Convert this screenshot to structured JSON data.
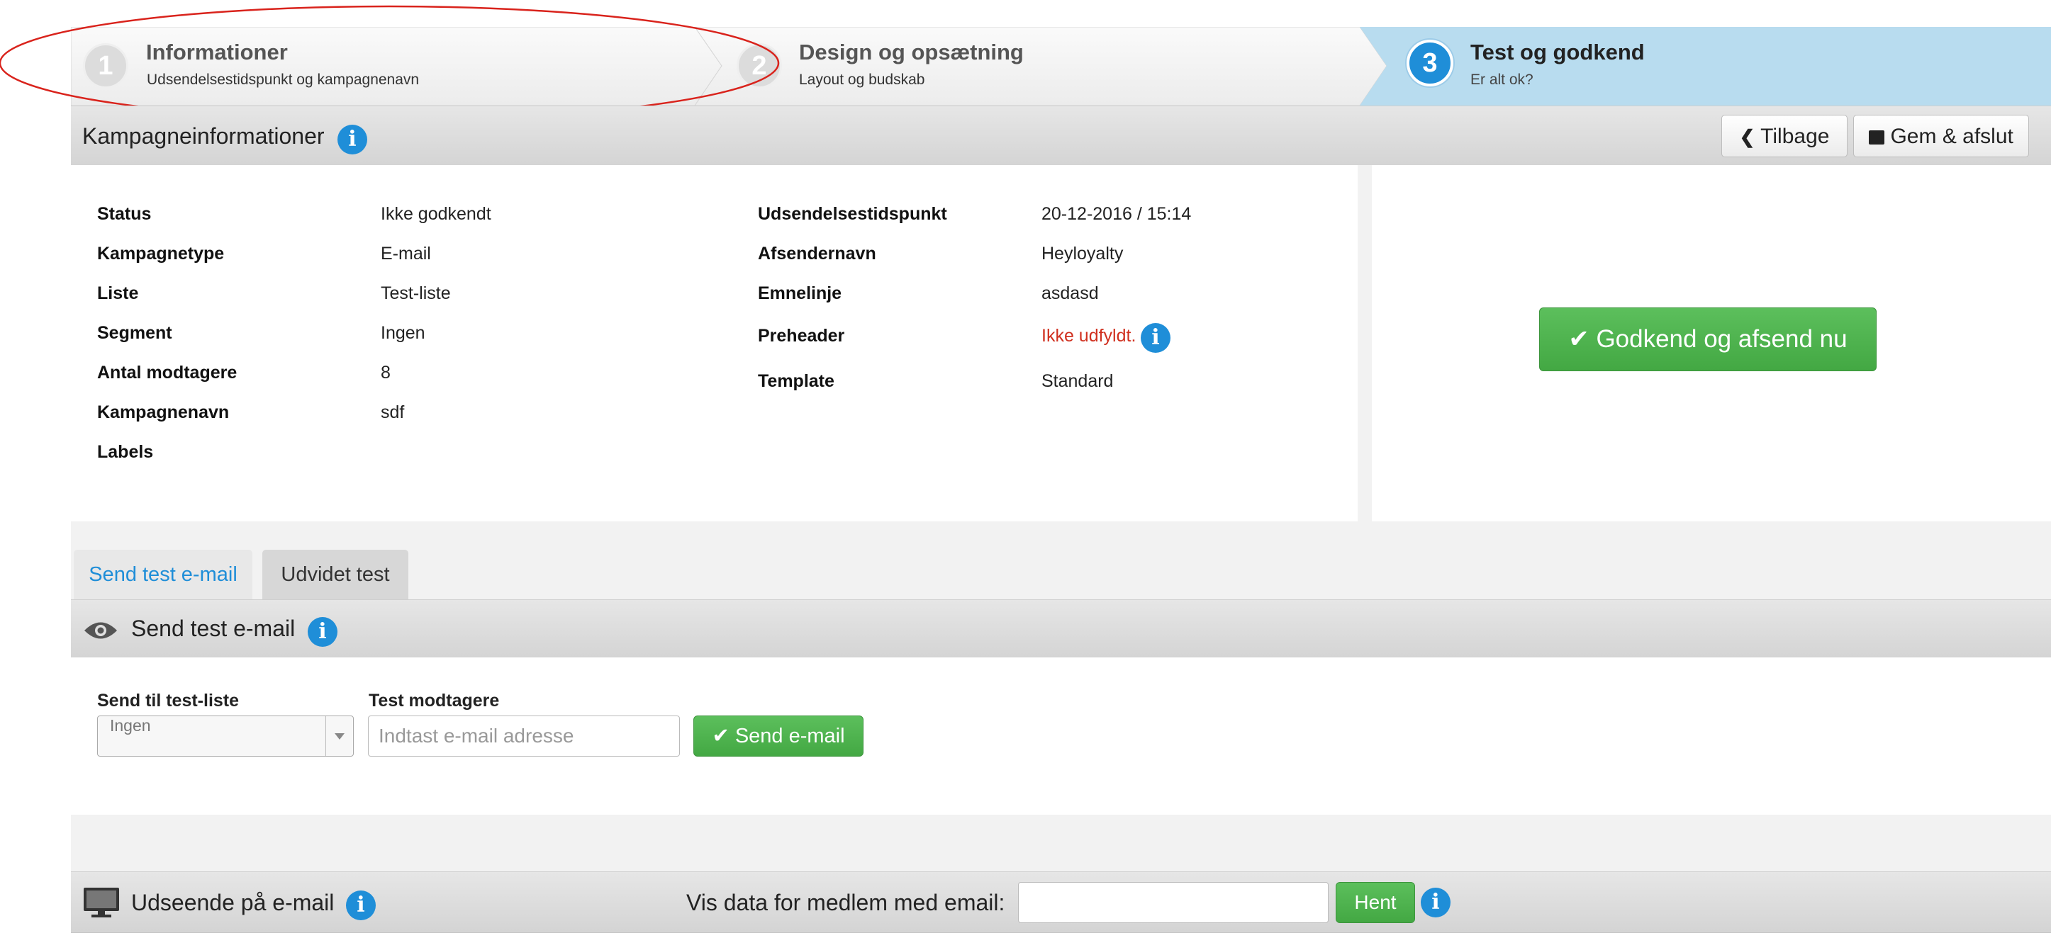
{
  "wizard": {
    "steps": [
      {
        "number": "1",
        "title": "Informationer",
        "subtitle": "Udsendelsestidspunkt og kampagnenavn"
      },
      {
        "number": "2",
        "title": "Design og opsætning",
        "subtitle": "Layout og budskab"
      },
      {
        "number": "3",
        "title": "Test og godkend",
        "subtitle": "Er alt ok?"
      }
    ],
    "active_step": 3,
    "colors": {
      "active_bg": "#b8dcef",
      "inactive_bg": "#f3f3f3",
      "annotation": "#d9231c"
    }
  },
  "campaign_info": {
    "header_title": "Kampagneinformationer",
    "back_label": "Tilbage",
    "save_label": "Gem & afslut",
    "left_fields": [
      {
        "label": "Status",
        "value": "Ikke godkendt"
      },
      {
        "label": "Kampagnetype",
        "value": "E-mail"
      },
      {
        "label": "Liste",
        "value": "Test-liste"
      },
      {
        "label": "Segment",
        "value": "Ingen"
      },
      {
        "label": "Antal modtagere",
        "value": "8"
      },
      {
        "label": "Kampagnenavn",
        "value": "sdf"
      },
      {
        "label": "Labels",
        "value": ""
      }
    ],
    "right_fields": [
      {
        "label": "Udsendelsestidspunkt",
        "value": "20-12-2016 / 15:14"
      },
      {
        "label": "Afsendernavn",
        "value": "Heyloyalty"
      },
      {
        "label": "Emnelinje",
        "value": "asdasd"
      },
      {
        "label": "Preheader",
        "value": "Ikke udfyldt."
      },
      {
        "label": "Template",
        "value": "Standard"
      }
    ],
    "approve_label": "Godkend og afsend nu"
  },
  "tabs": [
    {
      "label": "Send test e-mail",
      "active": true
    },
    {
      "label": "Udvidet test",
      "active": false
    }
  ],
  "test_section": {
    "title": "Send test e-mail",
    "list_label": "Send til test-liste",
    "list_value": "Ingen",
    "recipients_label": "Test modtagere",
    "recipients_placeholder": "Indtast e-mail adresse",
    "send_label": "Send e-mail"
  },
  "appearance_section": {
    "title": "Udseende på e-mail",
    "member_label": "Vis data for medlem med email:",
    "member_value": "",
    "fetch_label": "Hent"
  },
  "colors": {
    "accent": "#1f8ed8",
    "success": "#4cae4c",
    "warning": "#d0301f"
  }
}
